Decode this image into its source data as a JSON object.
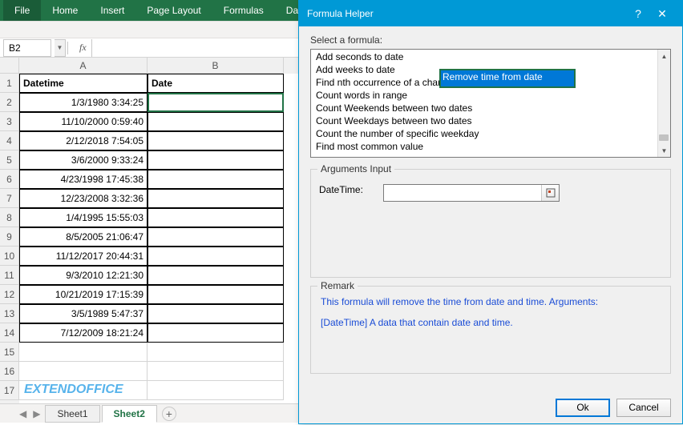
{
  "ribbon": {
    "tabs": [
      "File",
      "Home",
      "Insert",
      "Page Layout",
      "Formulas",
      "Data"
    ]
  },
  "namebox": "B2",
  "columns": [
    "A",
    "B"
  ],
  "headers": {
    "A": "Datetime",
    "B": "Date"
  },
  "rows": [
    "1/3/1980 3:34:25",
    "11/10/2000 0:59:40",
    "2/12/2018 7:54:05",
    "3/6/2000 9:33:24",
    "4/23/1998 17:45:38",
    "12/23/2008 3:32:36",
    "1/4/1995 15:55:03",
    "8/5/2005 21:06:47",
    "11/12/2017 20:44:31",
    "9/3/2010 12:21:30",
    "10/21/2019 17:15:39",
    "3/5/1989 5:47:37",
    "7/12/2009 18:21:24"
  ],
  "watermark": "EXTENDOFFICE",
  "sheets": {
    "items": [
      "Sheet1",
      "Sheet2"
    ],
    "active": "Sheet2"
  },
  "dialog": {
    "title": "Formula Helper",
    "select_label": "Select a formula:",
    "formulas": [
      "Add seconds to date",
      "Add weeks to date",
      "Find nth occurrence of a character",
      "Count words in range",
      "Count Weekends between two dates",
      "Count Weekdays between two dates",
      "Count the number of specific weekday",
      "Find most common value",
      "Remove time from date"
    ],
    "selected_formula": "Remove time from date",
    "args_group": "Arguments Input",
    "arg_label": "DateTime:",
    "arg_value": "",
    "remark_label": "Remark",
    "remark_line1": "This formula will remove the time from date and time. Arguments:",
    "remark_line2": "[DateTime] A data that contain date and time.",
    "ok": "Ok",
    "cancel": "Cancel"
  }
}
